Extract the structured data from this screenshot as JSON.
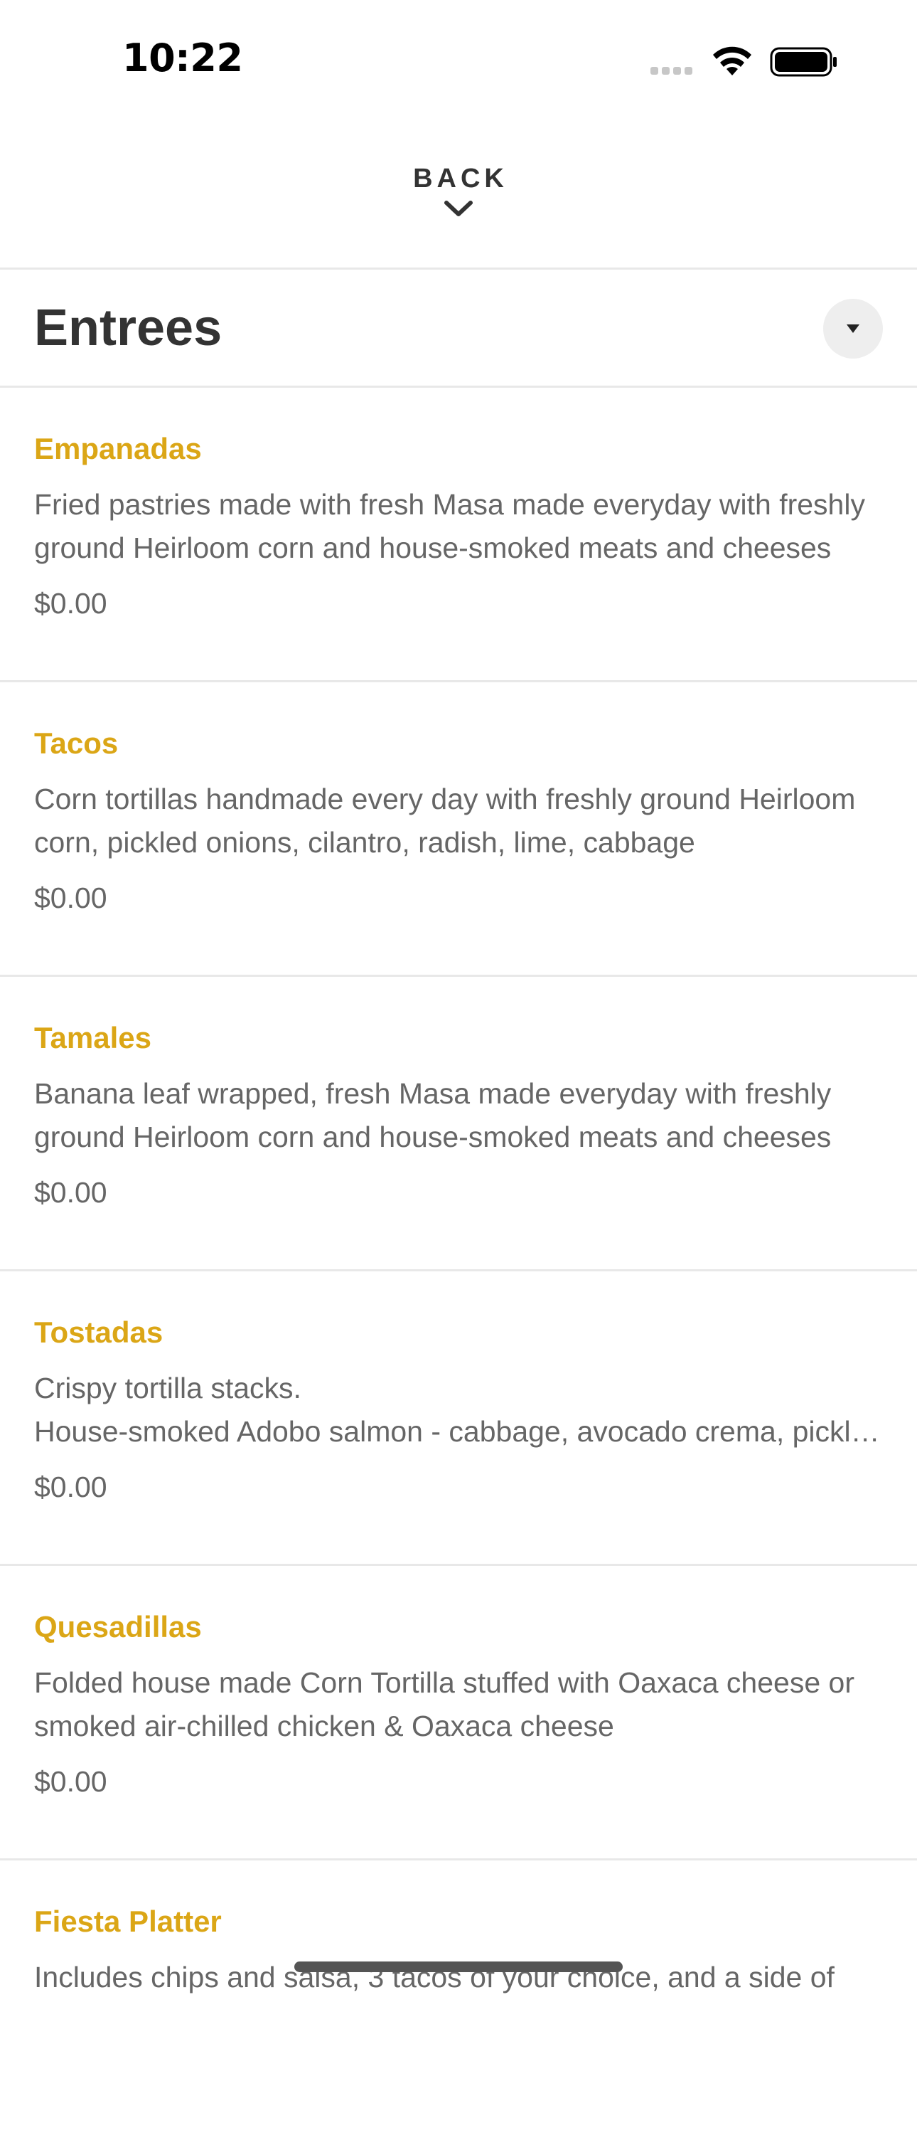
{
  "status_bar": {
    "time": "10:22"
  },
  "nav": {
    "back_label": "BACK"
  },
  "section": {
    "title": "Entrees"
  },
  "menu_items": [
    {
      "name": "Empanadas",
      "description": "Fried pastries made with fresh Masa made everyday with freshly ground Heirloom corn and house-smoked meats and cheeses",
      "price": "$0.00"
    },
    {
      "name": "Tacos",
      "description": "Corn tortillas handmade every day with freshly ground Heirloom corn, pickled onions, cilantro, radish, lime, cabbage",
      "price": "$0.00"
    },
    {
      "name": "Tamales",
      "description": "Banana leaf wrapped, fresh Masa made everyday with freshly ground Heirloom corn and house-smoked meats and cheeses",
      "price": "$0.00"
    },
    {
      "name": "Tostadas",
      "description": "Crispy tortilla stacks.\nHouse-smoked Adobo salmon - cabbage, avocado crema, pickled onions",
      "price": "$0.00"
    },
    {
      "name": "Quesadillas",
      "description": "Folded house made Corn Tortilla stuffed with Oaxaca cheese or smoked air-chilled chicken & Oaxaca cheese",
      "price": "$0.00"
    },
    {
      "name": "Fiesta Platter",
      "description": "Includes chips and salsa, 3 tacos of your choice, and a side of",
      "price": ""
    }
  ],
  "colors": {
    "accent": "#dba616",
    "text_primary": "#333333",
    "text_secondary": "#666666",
    "divider": "#e8e8e8"
  }
}
